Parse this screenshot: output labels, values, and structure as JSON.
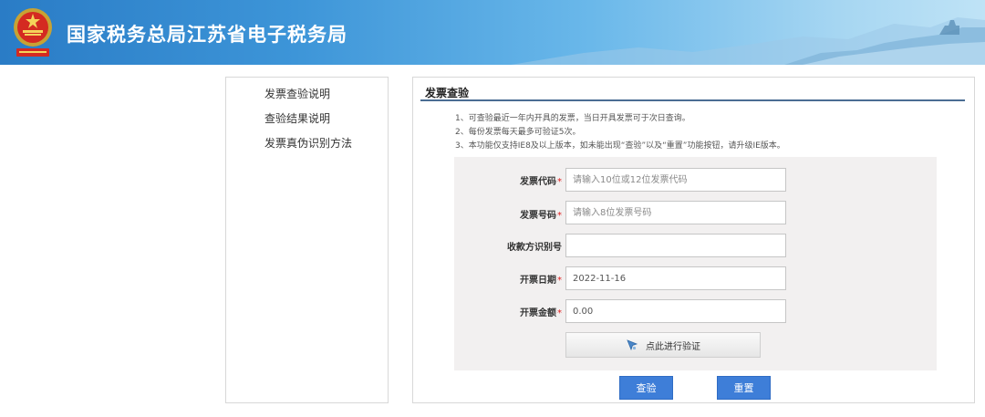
{
  "header": {
    "title": "国家税务总局江苏省电子税务局",
    "emblem_icon": "tax-emblem-icon",
    "colors": {
      "gradient_start": "#2a7cc6",
      "gradient_end": "#bfe3f6"
    }
  },
  "sidebar": {
    "items": [
      {
        "label": "发票查验说明"
      },
      {
        "label": "查验结果说明"
      },
      {
        "label": "发票真伪识别方法"
      }
    ]
  },
  "main": {
    "title": "发票查验",
    "notes": [
      "1、可查验最近一年内开具的发票，当日开具发票可于次日查询。",
      "2、每份发票每天最多可验证5次。",
      "3、本功能仅支持IE8及以上版本，如未能出现“查验”以及“重置”功能按钮，请升级IE版本。"
    ],
    "form": {
      "invoice_code": {
        "label": "发票代码",
        "required": "*",
        "value": "",
        "placeholder": "请输入10位或12位发票代码"
      },
      "invoice_number": {
        "label": "发票号码",
        "required": "*",
        "value": "",
        "placeholder": "请输入8位发票号码"
      },
      "payee_id": {
        "label": "收款方识别号",
        "value": "",
        "placeholder": ""
      },
      "issue_date": {
        "label": "开票日期",
        "required": "*",
        "value": "2022-11-16",
        "placeholder": ""
      },
      "amount": {
        "label": "开票金额",
        "required": "*",
        "value": "0.00",
        "placeholder": ""
      }
    },
    "verify_button": {
      "label": "点此进行验证",
      "icon": "pointer-cursor-icon"
    },
    "query_button": {
      "label": "查验"
    },
    "reset_button": {
      "label": "重置"
    },
    "colors": {
      "accent": "#3e7ed8",
      "rule": "#4a6d93",
      "required": "#e02020",
      "form_bg": "#f2f0f0"
    }
  }
}
